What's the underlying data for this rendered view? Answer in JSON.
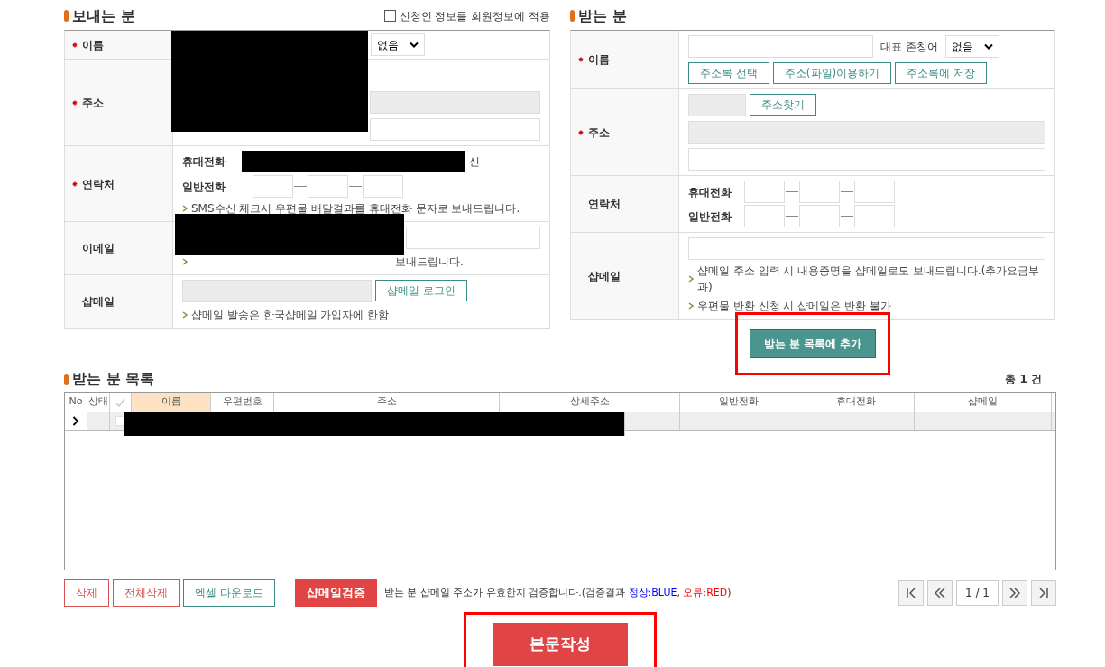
{
  "sender": {
    "title": "보내는 분",
    "apply_member": {
      "label": "신청인 정보를 회원정보에 적용",
      "checked": false
    },
    "name": {
      "label": "이름",
      "required": true,
      "honorific": "없음",
      "redacted": true
    },
    "address": {
      "label": "주소",
      "required": true
    },
    "contact": {
      "label": "연락처",
      "required": true,
      "mobile_label": "휴대전화",
      "mobile_redacted": true,
      "sms_tail": "신",
      "phone_label": "일반전화",
      "hint": "SMS수신 체크시 우편물 배달결과를 휴대전화 문자로 보내드립니다."
    },
    "email": {
      "label": "이메일",
      "required": false,
      "redacted": true,
      "hint_tail": "보내드립니다."
    },
    "shopmail": {
      "label": "샵메일",
      "required": false,
      "login_button": "샵메일 로그인",
      "hint": "샵메일 발송은 한국샵메일 가입자에 한함"
    }
  },
  "receiver": {
    "title": "받는 분",
    "name": {
      "label": "이름",
      "required": true,
      "honorific_label": "대표 존칭어",
      "honorific": "없음",
      "buttons": [
        "주소록 선택",
        "주소(파일)이용하기",
        "주소록에 저장"
      ]
    },
    "address": {
      "label": "주소",
      "required": true,
      "search_button": "주소찾기"
    },
    "contact": {
      "label": "연락처",
      "required": false,
      "mobile_label": "휴대전화",
      "phone_label": "일반전화"
    },
    "shopmail": {
      "label": "샵메일",
      "required": false,
      "hints": [
        "샵메일 주소 입력 시 내용증명을 샵메일로도 보내드립니다.(추가요금부과)",
        "우편물 반환 신청 시 샵메일은 반환 불가"
      ]
    },
    "add_button": {
      "label": "받는 분 목록에 추가",
      "highlighted": true
    }
  },
  "list": {
    "title": "받는 분 목록",
    "total": "총 1 건",
    "columns": [
      {
        "kind": "text",
        "label": "No",
        "highlighted": false
      },
      {
        "kind": "text",
        "label": "상태",
        "highlighted": false
      },
      {
        "kind": "check",
        "highlighted": false
      },
      {
        "kind": "text",
        "label": "이름",
        "highlighted": true
      },
      {
        "kind": "text",
        "label": "우편번호",
        "highlighted": false
      },
      {
        "kind": "text",
        "label": "주소",
        "highlighted": false
      },
      {
        "kind": "text",
        "label": "상세주소",
        "highlighted": false
      },
      {
        "kind": "text",
        "label": "일반전화",
        "highlighted": false
      },
      {
        "kind": "text",
        "label": "휴대전화",
        "highlighted": false
      },
      {
        "kind": "text",
        "label": "샵메일",
        "highlighted": false
      }
    ],
    "rows": [
      {
        "current": true,
        "checked": false,
        "redacted": true
      }
    ]
  },
  "footer": {
    "buttons": [
      {
        "kind": "danger-outline",
        "label": "삭제"
      },
      {
        "kind": "danger-outline",
        "label": "전체삭제"
      },
      {
        "kind": "teal-outline",
        "label": "엑셀 다운로드"
      },
      {
        "kind": "danger",
        "label": "샵메일검증"
      }
    ],
    "note": [
      {
        "text": "받는 분 샵메일 주소가 유효한지 검증합니다.(검증결과 "
      },
      {
        "text": "정상:BLUE",
        "color": "#0000ff"
      },
      {
        "text": ", "
      },
      {
        "text": "오류:RED",
        "color": "#ff0000"
      },
      {
        "text": ")"
      }
    ],
    "pager": {
      "page": "1 / 1"
    }
  },
  "submit": {
    "label": "본문작성",
    "highlighted": true
  }
}
